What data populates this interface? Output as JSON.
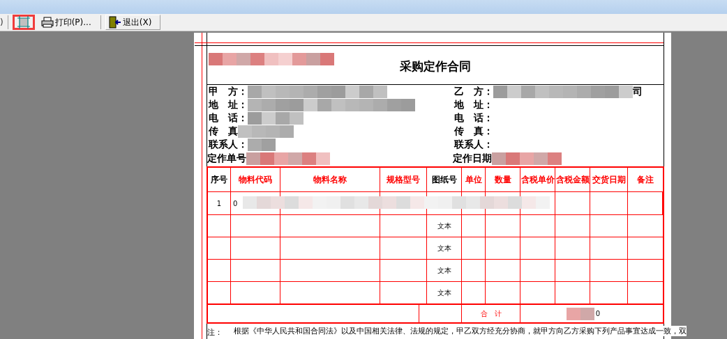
{
  "toolbar": {
    "cut_label": ")",
    "buttons": [
      {
        "kind": "grid",
        "highlighted": true
      },
      {
        "kind": "print",
        "label": "打印(P)...",
        "highlighted": false
      },
      {
        "kind": "exit",
        "label": "退出(X)",
        "highlighted": false
      }
    ]
  },
  "document": {
    "title": "采购定作合同",
    "party_a": [
      {
        "label": "甲　方："
      },
      {
        "label": "地　址："
      },
      {
        "label": "电　话："
      },
      {
        "label": "传　真"
      },
      {
        "label": "联系人："
      }
    ],
    "party_b": [
      {
        "label": "乙　方：",
        "tail": "司"
      },
      {
        "label": "地　址："
      },
      {
        "label": "电　话："
      },
      {
        "label": "传　真："
      },
      {
        "label": "联系人："
      }
    ],
    "order_no": {
      "label": "定作单号"
    },
    "order_date": {
      "label": "定作日期"
    },
    "table": {
      "columns": [
        {
          "label": "序号",
          "color": "#000000"
        },
        {
          "label": "物料代码",
          "color": "#ff0000"
        },
        {
          "label": "物料名称",
          "color": "#ff0000"
        },
        {
          "label": "规格型号",
          "color": "#ff0000"
        },
        {
          "label": "图纸号",
          "color": "#000000"
        },
        {
          "label": "单位",
          "color": "#ff0000"
        },
        {
          "label": "数量",
          "color": "#ff0000"
        },
        {
          "label": "含税单价",
          "color": "#ff0000"
        },
        {
          "label": "含税金额",
          "color": "#ff0000"
        },
        {
          "label": "交货日期",
          "color": "#ff0000"
        },
        {
          "label": "备注",
          "color": "#ff0000"
        }
      ],
      "rows": [
        {
          "cells": [
            "1",
            "0",
            "",
            "",
            "",
            "",
            "",
            "",
            "",
            "",
            ""
          ]
        },
        {
          "cells": [
            "",
            "",
            "",
            "",
            "文本",
            "",
            "",
            "",
            "",
            "",
            ""
          ]
        },
        {
          "cells": [
            "",
            "",
            "",
            "",
            "文本",
            "",
            "",
            "",
            "",
            "",
            ""
          ]
        },
        {
          "cells": [
            "",
            "",
            "",
            "",
            "文本",
            "",
            "",
            "",
            "",
            "",
            ""
          ]
        },
        {
          "cells": [
            "",
            "",
            "",
            "",
            "文本",
            "",
            "",
            "",
            "",
            "",
            ""
          ]
        }
      ],
      "total": {
        "label": "合　计",
        "value": "0"
      }
    },
    "note": {
      "label": "注：",
      "text": "根据《中华人民共和国合同法》以及中国相关法律、法规的规定，甲乙双方经充分协商，就甲方向乙方采购下列产品事宜达成一致，双"
    }
  }
}
